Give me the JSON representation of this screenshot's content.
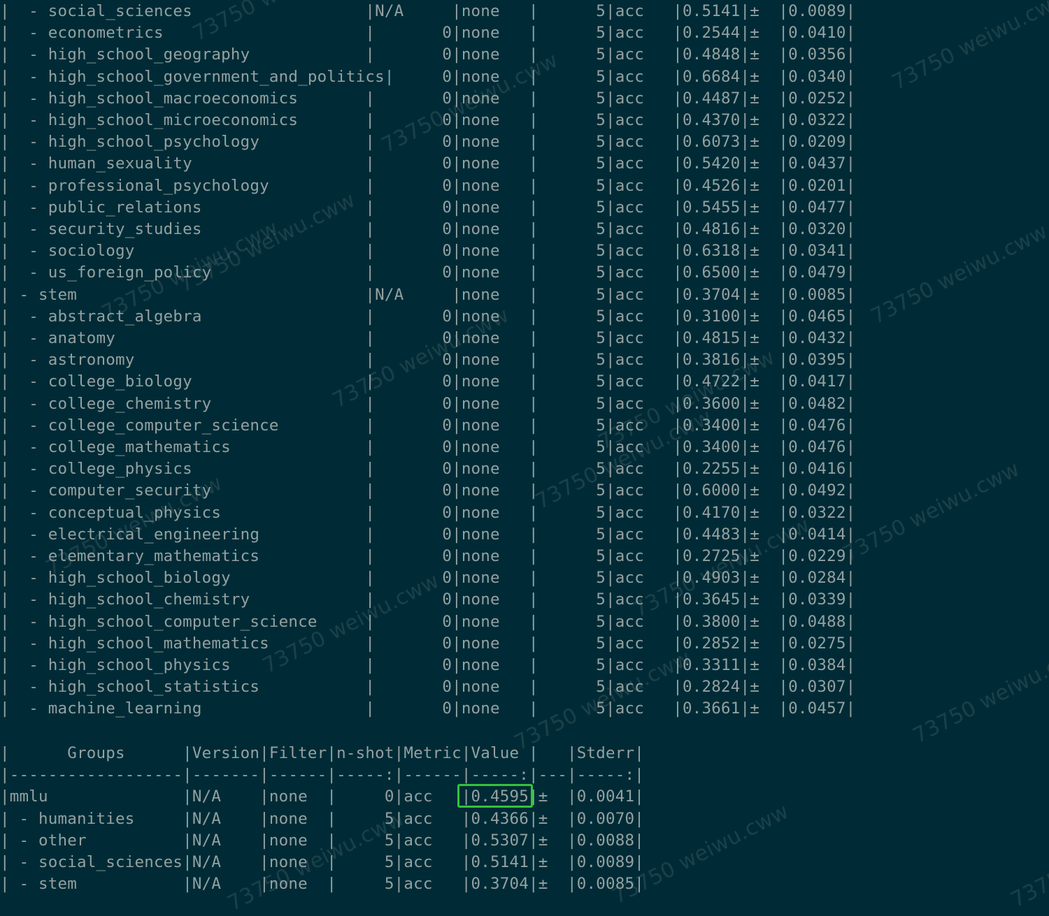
{
  "top_table_rows": [
    "|  - social_sciences                  |N/A     |none   |      5|acc   |0.5141|±  |0.0089|",
    "|  - econometrics                     |       0|none   |      5|acc   |0.2544|±  |0.0410|",
    "|  - high_school_geography            |       0|none   |      5|acc   |0.4848|±  |0.0356|",
    "|  - high_school_government_and_politics|     0|none   |      5|acc   |0.6684|±  |0.0340|",
    "|  - high_school_macroeconomics       |       0|none   |      5|acc   |0.4487|±  |0.0252|",
    "|  - high_school_microeconomics       |       0|none   |      5|acc   |0.4370|±  |0.0322|",
    "|  - high_school_psychology           |       0|none   |      5|acc   |0.6073|±  |0.0209|",
    "|  - human_sexuality                  |       0|none   |      5|acc   |0.5420|±  |0.0437|",
    "|  - professional_psychology          |       0|none   |      5|acc   |0.4526|±  |0.0201|",
    "|  - public_relations                 |       0|none   |      5|acc   |0.5455|±  |0.0477|",
    "|  - security_studies                 |       0|none   |      5|acc   |0.4816|±  |0.0320|",
    "|  - sociology                        |       0|none   |      5|acc   |0.6318|±  |0.0341|",
    "|  - us_foreign_policy                |       0|none   |      5|acc   |0.6500|±  |0.0479|",
    "| - stem                              |N/A     |none   |      5|acc   |0.3704|±  |0.0085|",
    "|  - abstract_algebra                 |       0|none   |      5|acc   |0.3100|±  |0.0465|",
    "|  - anatomy                          |       0|none   |      5|acc   |0.4815|±  |0.0432|",
    "|  - astronomy                        |       0|none   |      5|acc   |0.3816|±  |0.0395|",
    "|  - college_biology                  |       0|none   |      5|acc   |0.4722|±  |0.0417|",
    "|  - college_chemistry                |       0|none   |      5|acc   |0.3600|±  |0.0482|",
    "|  - college_computer_science         |       0|none   |      5|acc   |0.3400|±  |0.0476|",
    "|  - college_mathematics              |       0|none   |      5|acc   |0.3400|±  |0.0476|",
    "|  - college_physics                  |       0|none   |      5|acc   |0.2255|±  |0.0416|",
    "|  - computer_security                |       0|none   |      5|acc   |0.6000|±  |0.0492|",
    "|  - conceptual_physics               |       0|none   |      5|acc   |0.4170|±  |0.0322|",
    "|  - electrical_engineering           |       0|none   |      5|acc   |0.4483|±  |0.0414|",
    "|  - elementary_mathematics           |       0|none   |      5|acc   |0.2725|±  |0.0229|",
    "|  - high_school_biology              |       0|none   |      5|acc   |0.4903|±  |0.0284|",
    "|  - high_school_chemistry            |       0|none   |      5|acc   |0.3645|±  |0.0339|",
    "|  - high_school_computer_science     |       0|none   |      5|acc   |0.3800|±  |0.0488|",
    "|  - high_school_mathematics          |       0|none   |      5|acc   |0.2852|±  |0.0275|",
    "|  - high_school_physics              |       0|none   |      5|acc   |0.3311|±  |0.0384|",
    "|  - high_school_statistics           |       0|none   |      5|acc   |0.2824|±  |0.0307|",
    "|  - machine_learning                 |       0|none   |      5|acc   |0.3661|±  |0.0457|"
  ],
  "groups_table_rows": [
    "|      Groups      |Version|Filter|n-shot|Metric|Value |   |Stderr|",
    "|------------------|-------|------|-----:|------|-----:|---|-----:|",
    "|mmlu              |N/A    |none  |     0|acc   |0.4595|±  |0.0041|",
    "| - humanities     |N/A    |none  |     5|acc   |0.4366|±  |0.0070|",
    "| - other          |N/A    |none  |     5|acc   |0.5307|±  |0.0088|",
    "| - social_sciences|N/A    |none  |     5|acc   |0.5141|±  |0.0089|",
    "| - stem           |N/A    |none  |     5|acc   |0.3704|±  |0.0085|"
  ],
  "watermark_text": "73750 weiwu.cww",
  "colors": {
    "background": "#002b36",
    "foreground": "#93a1a1",
    "highlight": "#35c23a"
  }
}
